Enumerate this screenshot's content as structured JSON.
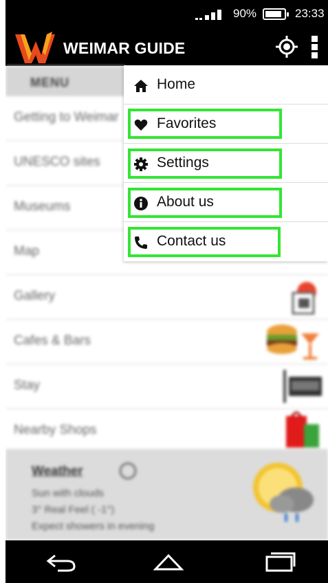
{
  "status_bar": {
    "battery_percent": "90%",
    "battery_level": 0.9,
    "time": "23:33",
    "icons": [
      "signal-icon",
      "battery-icon"
    ]
  },
  "app_bar": {
    "title": "WEIMAR GUIDE",
    "icons": [
      "app-logo",
      "locate-icon",
      "overflow-menu-icon"
    ]
  },
  "side_menu": {
    "header": "MENU",
    "items": [
      {
        "label": "Getting to Weimar"
      },
      {
        "label": "UNESCO sites"
      },
      {
        "label": "Museums"
      },
      {
        "label": "Map"
      },
      {
        "label": "Gallery"
      },
      {
        "label": "Cafes & Bars"
      },
      {
        "label": "Stay"
      },
      {
        "label": "Nearby Shops"
      }
    ]
  },
  "weather": {
    "title": "Weather",
    "line1": "Sun with clouds",
    "line2": "3° Real Feel ( -1°)",
    "line3": "Expect showers in evening"
  },
  "dropdown": {
    "items": [
      {
        "label": "Home",
        "icon": "home-icon"
      },
      {
        "label": "Favorites",
        "icon": "heart-icon"
      },
      {
        "label": "Settings",
        "icon": "gear-icon"
      },
      {
        "label": "About us",
        "icon": "info-icon"
      },
      {
        "label": "Contact us",
        "icon": "phone-icon"
      }
    ]
  },
  "colors": {
    "app_bar": "#000000",
    "logo_primary": "#e8491d",
    "logo_secondary": "#f6a21c",
    "highlight": "#33e533"
  },
  "nav_bar": {
    "icons": [
      "back-icon",
      "home-nav-icon",
      "recents-icon"
    ]
  }
}
